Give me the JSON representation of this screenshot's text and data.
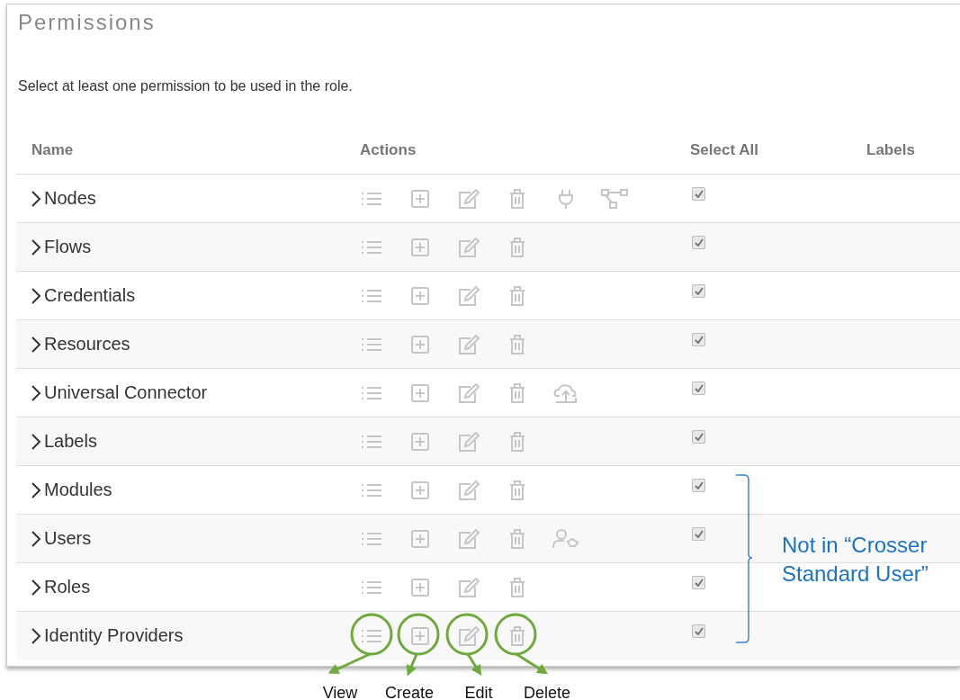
{
  "title": "Permissions",
  "description": "Select at least one permission to be used in the role.",
  "columns": [
    "Name",
    "Actions",
    "Select All",
    "Labels"
  ],
  "rows": [
    {
      "name": "Nodes",
      "expanded": false,
      "checked": true,
      "extra_actions": [
        {
          "kind": "plug"
        },
        {
          "kind": "network"
        }
      ]
    },
    {
      "name": "Flows",
      "expanded": false,
      "checked": true
    },
    {
      "name": "Credentials",
      "expanded": false,
      "checked": true
    },
    {
      "name": "Resources",
      "expanded": false,
      "checked": true
    },
    {
      "name": "Universal Connector",
      "expanded": false,
      "checked": true,
      "extra_actions": [
        {
          "kind": "upload"
        }
      ]
    },
    {
      "name": "Labels",
      "expanded": false,
      "checked": true
    },
    {
      "name": "Modules",
      "expanded": false,
      "checked": true
    },
    {
      "name": "Users",
      "expanded": false,
      "checked": true,
      "extra_actions": [
        {
          "kind": "user-tag"
        }
      ]
    },
    {
      "name": "Roles",
      "expanded": false,
      "checked": true
    },
    {
      "name": "Identity Providers",
      "expanded": false,
      "checked": true
    }
  ],
  "annotations": {
    "action_labels": [
      "View",
      "Create",
      "Edit",
      "Delete"
    ],
    "bracket_note": "Not in “Crosser Standard User”"
  }
}
